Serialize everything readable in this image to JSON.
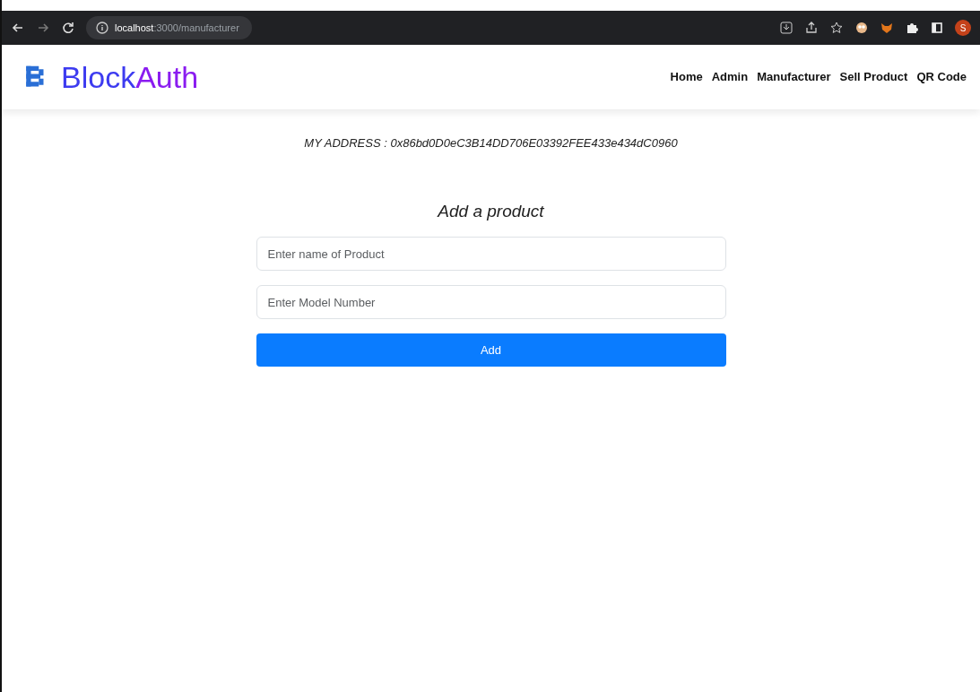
{
  "browser": {
    "url": "**localhost**:3000/manufacturer",
    "profile_initial": "S"
  },
  "navbar": {
    "brand_parts": [
      {
        "text": "Block",
        "color": "#3d3bf0"
      },
      {
        "text": "Auth",
        "color": "#8a1cf0"
      }
    ],
    "links": [
      {
        "label": "Home"
      },
      {
        "label": "Admin"
      },
      {
        "label": "Manufacturer"
      },
      {
        "label": "Sell Product"
      },
      {
        "label": "QR Code"
      }
    ]
  },
  "address": "MY ADDRESS : 0x86bd0D0eC3B14DD706E03392FEE433e434dC0960",
  "form": {
    "title": "Add a product",
    "fields": [
      {
        "placeholder": "Enter name of Product"
      },
      {
        "placeholder": "Enter Model Number"
      }
    ],
    "button": "Add"
  }
}
